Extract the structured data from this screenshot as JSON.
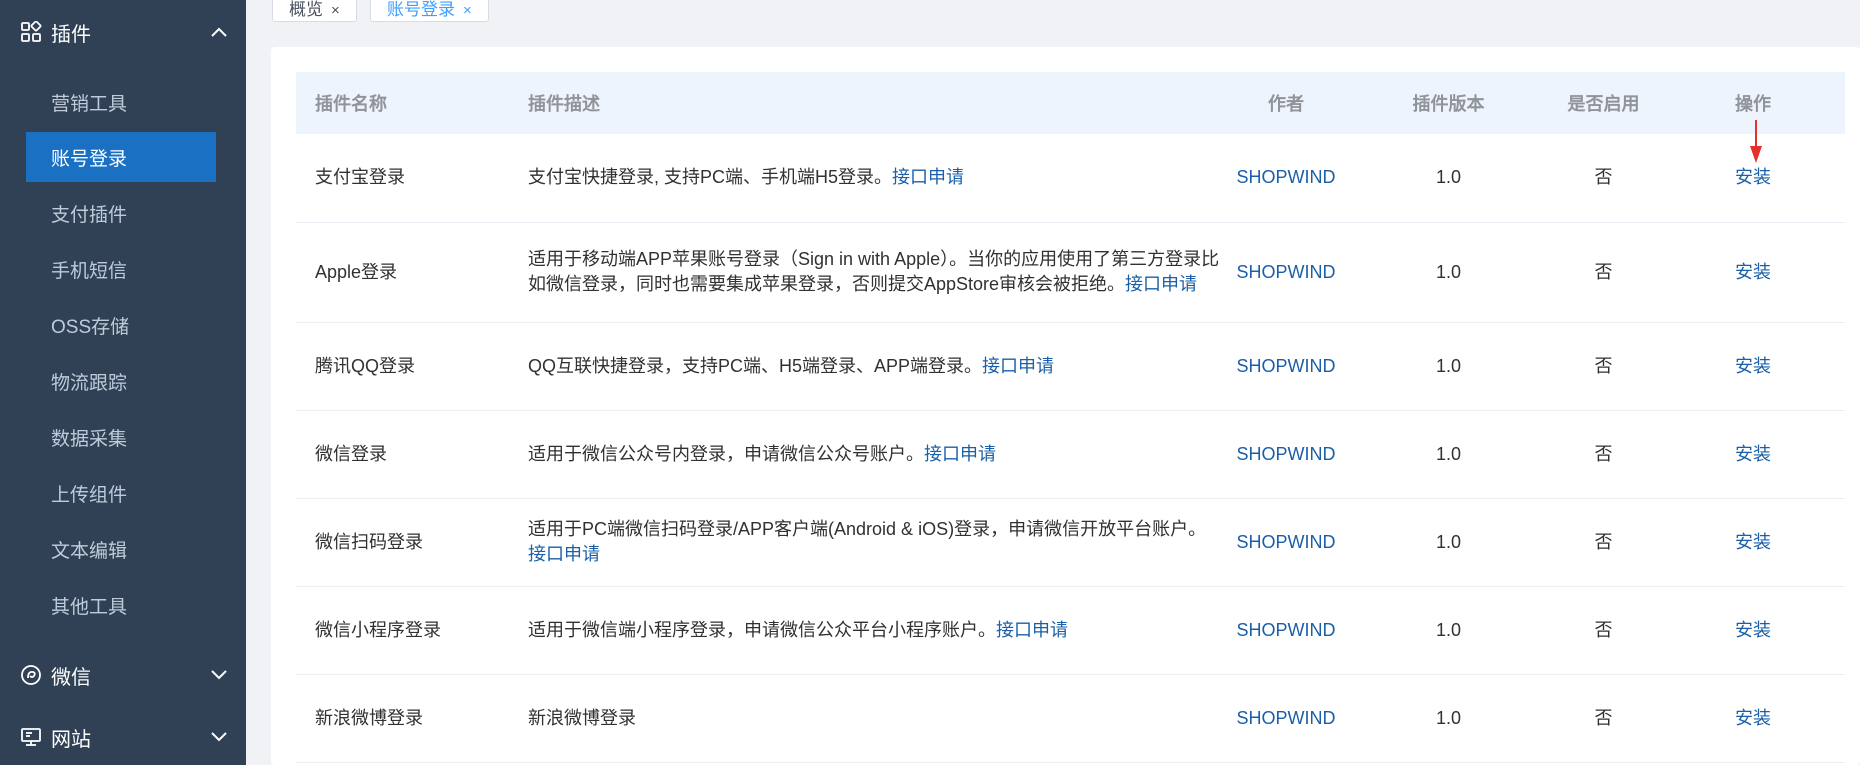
{
  "sidebar": {
    "plugin_group": {
      "label": "插件",
      "icon": "grid-icon",
      "expanded": true
    },
    "items": [
      {
        "label": "营销工具",
        "active": false
      },
      {
        "label": "账号登录",
        "active": true
      },
      {
        "label": "支付插件",
        "active": false
      },
      {
        "label": "手机短信",
        "active": false
      },
      {
        "label": "OSS存储",
        "active": false
      },
      {
        "label": "物流跟踪",
        "active": false
      },
      {
        "label": "数据采集",
        "active": false
      },
      {
        "label": "上传组件",
        "active": false
      },
      {
        "label": "文本编辑",
        "active": false
      },
      {
        "label": "其他工具",
        "active": false
      }
    ],
    "wechat_group": {
      "label": "微信",
      "icon": "wechat-icon",
      "expanded": false
    },
    "website_group": {
      "label": "网站",
      "icon": "monitor-icon",
      "expanded": false
    }
  },
  "tags": [
    {
      "label": "概览",
      "close": "×",
      "active": false
    },
    {
      "label": "账号登录",
      "close": "×",
      "active": true
    }
  ],
  "table": {
    "headers": {
      "name": "插件名称",
      "desc": "插件描述",
      "author": "作者",
      "version": "插件版本",
      "enabled": "是否启用",
      "action": "操作"
    },
    "rows": [
      {
        "name": "支付宝登录",
        "desc": "支付宝快捷登录, 支持PC端、手机端H5登录。",
        "link": "接口申请",
        "author": "SHOPWIND",
        "version": "1.0",
        "enabled": "否",
        "action": "安装"
      },
      {
        "name": "Apple登录",
        "desc": "适用于移动端APP苹果账号登录（Sign in with Apple）。当你的应用使用了第三方登录比如微信登录，同时也需要集成苹果登录，否则提交AppStore审核会被拒绝。",
        "link": "接口申请",
        "author": "SHOPWIND",
        "version": "1.0",
        "enabled": "否",
        "action": "安装"
      },
      {
        "name": "腾讯QQ登录",
        "desc": "QQ互联快捷登录，支持PC端、H5端登录、APP端登录。",
        "link": "接口申请",
        "author": "SHOPWIND",
        "version": "1.0",
        "enabled": "否",
        "action": "安装"
      },
      {
        "name": "微信登录",
        "desc": "适用于微信公众号内登录，申请微信公众号账户。",
        "link": "接口申请",
        "author": "SHOPWIND",
        "version": "1.0",
        "enabled": "否",
        "action": "安装"
      },
      {
        "name": "微信扫码登录",
        "desc": "适用于PC端微信扫码登录/APP客户端(Android & iOS)登录，申请微信开放平台账户。",
        "link": "接口申请",
        "author": "SHOPWIND",
        "version": "1.0",
        "enabled": "否",
        "action": "安装"
      },
      {
        "name": "微信小程序登录",
        "desc": "适用于微信端小程序登录，申请微信公众平台小程序账户。",
        "link": "接口申请",
        "author": "SHOPWIND",
        "version": "1.0",
        "enabled": "否",
        "action": "安装"
      },
      {
        "name": "新浪微博登录",
        "desc": "新浪微博登录",
        "link": "",
        "author": "SHOPWIND",
        "version": "1.0",
        "enabled": "否",
        "action": "安装"
      }
    ]
  },
  "colors": {
    "sidebar_bg": "#304156",
    "active_item": "#1a70c3",
    "link": "#1a5fa8",
    "header_bg": "#eef4fd",
    "annotation_arrow": "#e8302a"
  }
}
